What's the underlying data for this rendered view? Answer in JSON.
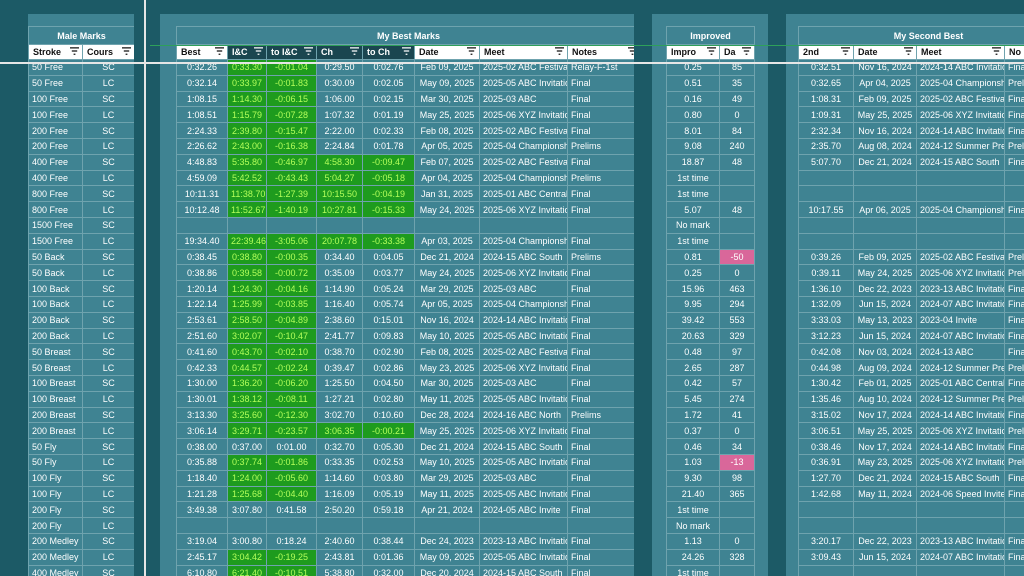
{
  "colors": {
    "background": "#1c5a66",
    "panel": "#3f8392",
    "green_cell": "#1e9b1e",
    "green_text": "#b3ff5a",
    "pink_cell": "#d9679a"
  },
  "icons": {
    "filter": "filter-icon"
  },
  "panels": {
    "male_marks": {
      "title": "Male Marks",
      "headers": [
        "Stroke",
        "Cours"
      ],
      "rows": [
        [
          "50 Free",
          "SC"
        ],
        [
          "50 Free",
          "LC"
        ],
        [
          "100 Free",
          "SC"
        ],
        [
          "100 Free",
          "LC"
        ],
        [
          "200 Free",
          "SC"
        ],
        [
          "200 Free",
          "LC"
        ],
        [
          "400 Free",
          "SC"
        ],
        [
          "400 Free",
          "LC"
        ],
        [
          "800 Free",
          "SC"
        ],
        [
          "800 Free",
          "LC"
        ],
        [
          "1500 Free",
          "SC"
        ],
        [
          "1500 Free",
          "LC"
        ],
        [
          "50 Back",
          "SC"
        ],
        [
          "50 Back",
          "LC"
        ],
        [
          "100 Back",
          "SC"
        ],
        [
          "100 Back",
          "LC"
        ],
        [
          "200 Back",
          "SC"
        ],
        [
          "200 Back",
          "LC"
        ],
        [
          "50 Breast",
          "SC"
        ],
        [
          "50 Breast",
          "LC"
        ],
        [
          "100 Breast",
          "SC"
        ],
        [
          "100 Breast",
          "LC"
        ],
        [
          "200 Breast",
          "SC"
        ],
        [
          "200 Breast",
          "LC"
        ],
        [
          "50 Fly",
          "SC"
        ],
        [
          "50 Fly",
          "LC"
        ],
        [
          "100 Fly",
          "SC"
        ],
        [
          "100 Fly",
          "LC"
        ],
        [
          "200 Fly",
          "SC"
        ],
        [
          "200 Fly",
          "LC"
        ],
        [
          "200 Medley",
          "SC"
        ],
        [
          "200 Medley",
          "LC"
        ],
        [
          "400 Medley",
          "SC"
        ]
      ]
    },
    "best": {
      "title": "My Best Marks",
      "headers": [
        "Best",
        "I&C",
        "to I&C",
        "Ch",
        "to Ch",
        "Date",
        "Meet",
        "Notes"
      ],
      "rows": [
        [
          "0:32.26",
          "0:33.30",
          "-0:01.04",
          "0:29.50",
          "0:02.76",
          "Feb 09, 2025",
          "2025-02 ABC Festival",
          "Relay-F-1st"
        ],
        [
          "0:32.14",
          "0:33.97",
          "-0:01.83",
          "0:30.09",
          "0:02.05",
          "May 09, 2025",
          "2025-05 ABC Invitational",
          "Final"
        ],
        [
          "1:08.15",
          "1:14.30",
          "-0:06.15",
          "1:06.00",
          "0:02.15",
          "Mar 30, 2025",
          "2025-03 ABC",
          "Final"
        ],
        [
          "1:08.51",
          "1:15.79",
          "-0:07.28",
          "1:07.32",
          "0:01.19",
          "May 25, 2025",
          "2025-06 XYZ Invitational",
          "Final"
        ],
        [
          "2:24.33",
          "2:39.80",
          "-0:15.47",
          "2:22.00",
          "0:02.33",
          "Feb 08, 2025",
          "2025-02 ABC Festival",
          "Final"
        ],
        [
          "2:26.62",
          "2:43.00",
          "-0:16.38",
          "2:24.84",
          "0:01.78",
          "Apr 05, 2025",
          "2025-04 Championship",
          "Prelims"
        ],
        [
          "4:48.83",
          "5:35.80",
          "-0:46.97",
          "4:58.30",
          "-0:09.47",
          "Feb 07, 2025",
          "2025-02 ABC Festival",
          "Final"
        ],
        [
          "4:59.09",
          "5:42.52",
          "-0:43.43",
          "5:04.27",
          "-0:05.18",
          "Apr 04, 2025",
          "2025-04 Championship",
          "Prelims"
        ],
        [
          "10:11.31",
          "11:38.70",
          "-1:27.39",
          "10:15.50",
          "-0:04.19",
          "Jan 31, 2025",
          "2025-01 ABC Central",
          "Final"
        ],
        [
          "10:12.48",
          "11:52.67",
          "-1:40.19",
          "10:27.81",
          "-0:15.33",
          "May 24, 2025",
          "2025-06 XYZ Invitational",
          "Final"
        ],
        [
          "",
          "",
          "",
          "",
          "",
          "",
          "",
          ""
        ],
        [
          "19:34.40",
          "22:39.46",
          "-3:05.06",
          "20:07.78",
          "-0:33.38",
          "Apr 03, 2025",
          "2025-04 Championship",
          "Final"
        ],
        [
          "0:38.45",
          "0:38.80",
          "-0:00.35",
          "0:34.40",
          "0:04.05",
          "Dec 21, 2024",
          "2024-15 ABC South",
          "Prelims"
        ],
        [
          "0:38.86",
          "0:39.58",
          "-0:00.72",
          "0:35.09",
          "0:03.77",
          "May 24, 2025",
          "2025-06 XYZ Invitational",
          "Final"
        ],
        [
          "1:20.14",
          "1:24.30",
          "-0:04.16",
          "1:14.90",
          "0:05.24",
          "Mar 29, 2025",
          "2025-03 ABC",
          "Final"
        ],
        [
          "1:22.14",
          "1:25.99",
          "-0:03.85",
          "1:16.40",
          "0:05.74",
          "Apr 05, 2025",
          "2025-04 Championship",
          "Final"
        ],
        [
          "2:53.61",
          "2:58.50",
          "-0:04.89",
          "2:38.60",
          "0:15.01",
          "Nov 16, 2024",
          "2024-14 ABC Invitational",
          "Final"
        ],
        [
          "2:51.60",
          "3:02.07",
          "-0:10.47",
          "2:41.77",
          "0:09.83",
          "May 10, 2025",
          "2025-05 ABC Invitational",
          "Final"
        ],
        [
          "0:41.60",
          "0:43.70",
          "-0:02.10",
          "0:38.70",
          "0:02.90",
          "Feb 08, 2025",
          "2025-02 ABC Festival",
          "Final"
        ],
        [
          "0:42.33",
          "0:44.57",
          "-0:02.24",
          "0:39.47",
          "0:02.86",
          "May 23, 2025",
          "2025-06 XYZ Invitational",
          "Final"
        ],
        [
          "1:30.00",
          "1:36.20",
          "-0:06.20",
          "1:25.50",
          "0:04.50",
          "Mar 30, 2025",
          "2025-03 ABC",
          "Final"
        ],
        [
          "1:30.01",
          "1:38.12",
          "-0:08.11",
          "1:27.21",
          "0:02.80",
          "May 11, 2025",
          "2025-05 ABC Invitational",
          "Final"
        ],
        [
          "3:13.30",
          "3:25.60",
          "-0:12.30",
          "3:02.70",
          "0:10.60",
          "Dec 28, 2024",
          "2024-16 ABC North",
          "Prelims"
        ],
        [
          "3:06.14",
          "3:29.71",
          "-0:23.57",
          "3:06.35",
          "-0:00.21",
          "May 25, 2025",
          "2025-06 XYZ Invitational",
          "Final"
        ],
        [
          "0:38.00",
          "0:37.00",
          "0:01.00",
          "0:32.70",
          "0:05.30",
          "Dec 21, 2024",
          "2024-15 ABC South",
          "Final"
        ],
        [
          "0:35.88",
          "0:37.74",
          "-0:01.86",
          "0:33.35",
          "0:02.53",
          "May 10, 2025",
          "2025-05 ABC Invitational",
          "Final"
        ],
        [
          "1:18.40",
          "1:24.00",
          "-0:05.60",
          "1:14.60",
          "0:03.80",
          "Mar 29, 2025",
          "2025-03 ABC",
          "Final"
        ],
        [
          "1:21.28",
          "1:25.68",
          "-0:04.40",
          "1:16.09",
          "0:05.19",
          "May 11, 2025",
          "2025-05 ABC Invitational",
          "Final"
        ],
        [
          "3:49.38",
          "3:07.80",
          "0:41.58",
          "2:50.20",
          "0:59.18",
          "Apr 21, 2024",
          "2024-05 ABC Invite",
          "Final"
        ],
        [
          "",
          "",
          "",
          "",
          "",
          "",
          "",
          ""
        ],
        [
          "3:19.04",
          "3:00.80",
          "0:18.24",
          "2:40.60",
          "0:38.44",
          "Dec 24, 2023",
          "2023-13 ABC Invitational",
          "Final"
        ],
        [
          "2:45.17",
          "3:04.42",
          "-0:19.25",
          "2:43.81",
          "0:01.36",
          "May 09, 2025",
          "2025-05 ABC Invitational",
          "Final"
        ],
        [
          "6:10.80",
          "6:21.40",
          "-0:10.51",
          "5:38.80",
          "0:32.00",
          "Dec 20, 2024",
          "2024-15 ABC South",
          "Final"
        ]
      ],
      "green_ic": [
        0,
        1,
        2,
        3,
        4,
        5,
        6,
        7,
        8,
        9,
        11,
        12,
        13,
        14,
        15,
        16,
        17,
        18,
        19,
        20,
        21,
        22,
        23,
        25,
        26,
        27,
        31,
        32
      ],
      "green_ch": [
        6,
        7,
        8,
        9,
        11,
        23
      ]
    },
    "improved": {
      "title": "Improved",
      "headers": [
        "Impro",
        "Da"
      ],
      "rows": [
        [
          "0.25",
          "85"
        ],
        [
          "0.51",
          "35"
        ],
        [
          "0.16",
          "49"
        ],
        [
          "0.80",
          "0"
        ],
        [
          "8.01",
          "84"
        ],
        [
          "9.08",
          "240"
        ],
        [
          "18.87",
          "48"
        ],
        [
          "1st time",
          ""
        ],
        [
          "1st time",
          ""
        ],
        [
          "5.07",
          "48"
        ],
        [
          "No mark",
          ""
        ],
        [
          "1st time",
          ""
        ],
        [
          "0.81",
          "-50"
        ],
        [
          "0.25",
          "0"
        ],
        [
          "15.96",
          "463"
        ],
        [
          "9.95",
          "294"
        ],
        [
          "39.42",
          "553"
        ],
        [
          "20.63",
          "329"
        ],
        [
          "0.48",
          "97"
        ],
        [
          "2.65",
          "287"
        ],
        [
          "0.42",
          "57"
        ],
        [
          "5.45",
          "274"
        ],
        [
          "1.72",
          "41"
        ],
        [
          "0.37",
          "0"
        ],
        [
          "0.46",
          "34"
        ],
        [
          "1.03",
          "-13"
        ],
        [
          "9.30",
          "98"
        ],
        [
          "21.40",
          "365"
        ],
        [
          "1st time",
          ""
        ],
        [
          "No mark",
          ""
        ],
        [
          "1.13",
          "0"
        ],
        [
          "24.26",
          "328"
        ],
        [
          "1st time",
          ""
        ]
      ],
      "pink": [
        12,
        25
      ]
    },
    "second_best": {
      "title": "My Second Best",
      "headers": [
        "2nd",
        "Date",
        "Meet",
        "No"
      ],
      "rows": [
        [
          "0:32.51",
          "Nov 16, 2024",
          "2024-14 ABC Invitational",
          "Final"
        ],
        [
          "0:32.65",
          "Apr 04, 2025",
          "2025-04 Championship",
          "Prelims"
        ],
        [
          "1:08.31",
          "Feb 09, 2025",
          "2025-02 ABC Festival",
          "Final"
        ],
        [
          "1:09.31",
          "May 25, 2025",
          "2025-06 XYZ Invitational",
          "Final"
        ],
        [
          "2:32.34",
          "Nov 16, 2024",
          "2024-14 ABC Invitational",
          "Final"
        ],
        [
          "2:35.70",
          "Aug 08, 2024",
          "2024-12 Summer Prelims",
          "Prelims"
        ],
        [
          "5:07.70",
          "Dec 21, 2024",
          "2024-15 ABC South",
          "Final"
        ],
        [
          "",
          "",
          "",
          ""
        ],
        [
          "",
          "",
          "",
          ""
        ],
        [
          "10:17.55",
          "Apr 06, 2025",
          "2025-04 Championship",
          "Final"
        ],
        [
          "",
          "",
          "",
          ""
        ],
        [
          "",
          "",
          "",
          ""
        ],
        [
          "0:39.26",
          "Feb 09, 2025",
          "2025-02 ABC Festival",
          "Prelims"
        ],
        [
          "0:39.11",
          "May 24, 2025",
          "2025-06 XYZ Invitational",
          "Prelims"
        ],
        [
          "1:36.10",
          "Dec 22, 2023",
          "2023-13 ABC Invitational",
          "Final"
        ],
        [
          "1:32.09",
          "Jun 15, 2024",
          "2024-07 ABC Invitational",
          "Final"
        ],
        [
          "3:33.03",
          "May 13, 2023",
          "2023-04 Invite",
          "Final"
        ],
        [
          "3:12.23",
          "Jun 15, 2024",
          "2024-07 ABC Invitational",
          "Final"
        ],
        [
          "0:42.08",
          "Nov 03, 2024",
          "2024-13 ABC",
          "Final"
        ],
        [
          "0:44.98",
          "Aug 09, 2024",
          "2024-12 Summer Prelims",
          "Prelims"
        ],
        [
          "1:30.42",
          "Feb 01, 2025",
          "2025-01 ABC Central",
          "Final"
        ],
        [
          "1:35.46",
          "Aug 10, 2024",
          "2024-12 Summer Prelims",
          "Prelims"
        ],
        [
          "3:15.02",
          "Nov 17, 2024",
          "2024-14 ABC Invitational",
          "Final"
        ],
        [
          "3:06.51",
          "May 25, 2025",
          "2025-06 XYZ Invitational",
          "Prelims"
        ],
        [
          "0:38.46",
          "Nov 17, 2024",
          "2024-14 ABC Invitational",
          "Final"
        ],
        [
          "0:36.91",
          "May 23, 2025",
          "2025-06 XYZ Invitational",
          "Prelims"
        ],
        [
          "1:27.70",
          "Dec 21, 2024",
          "2024-15 ABC South",
          "Final"
        ],
        [
          "1:42.68",
          "May 11, 2024",
          "2024-06 Speed Invite",
          "Final"
        ],
        [
          "",
          "",
          "",
          ""
        ],
        [
          "",
          "",
          "",
          ""
        ],
        [
          "3:20.17",
          "Dec 22, 2023",
          "2023-13 ABC Invitational",
          "Final"
        ],
        [
          "3:09.43",
          "Jun 15, 2024",
          "2024-07 ABC Invitational",
          "Final"
        ],
        [
          "",
          "",
          "",
          ""
        ]
      ]
    }
  }
}
